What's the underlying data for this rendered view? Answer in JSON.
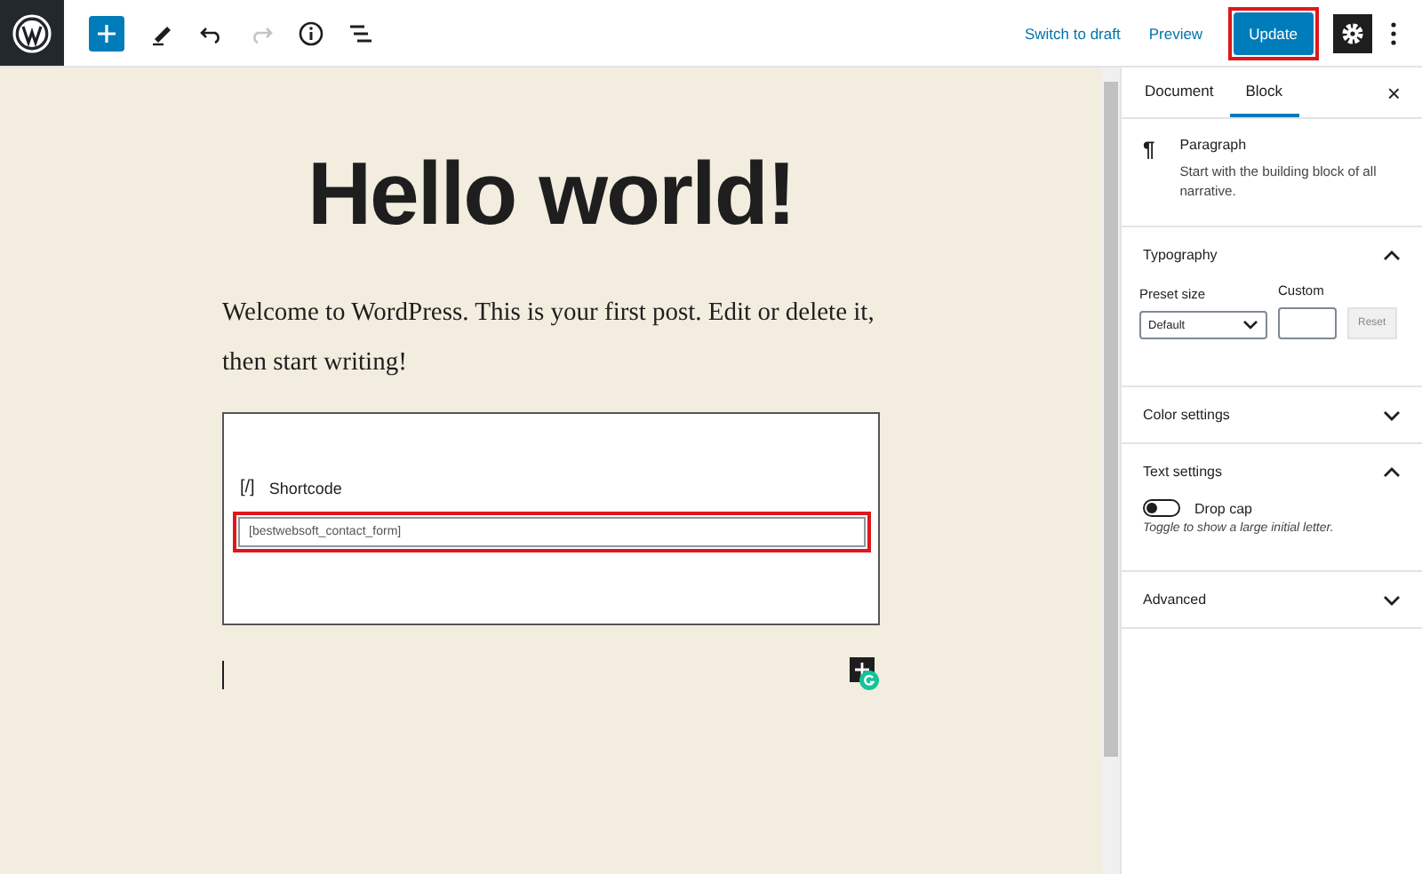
{
  "toolbar": {
    "actions": [
      {
        "label": "Switch to draft",
        "kind": "link"
      },
      {
        "label": "Preview",
        "kind": "link"
      },
      {
        "label": "Update",
        "kind": "primary",
        "highlighted": true
      }
    ],
    "settings_on": true
  },
  "post": {
    "title": "Hello world!",
    "paragraph": "Welcome to WordPress. This is your first post. Edit or delete it, then start writing!",
    "shortcode": {
      "label": "Shortcode",
      "icon": "[/]",
      "value": "[bestwebsoft_contact_form]",
      "highlighted": true
    }
  },
  "sidebar": {
    "tabs": [
      {
        "label": "Document",
        "selected": false
      },
      {
        "label": "Block",
        "selected": true
      }
    ],
    "close": "×",
    "block": {
      "icon": "¶",
      "name": "Paragraph",
      "description": "Start with the building block of all narrative."
    },
    "panels": [
      {
        "kind": "typography",
        "title": "Typography",
        "expanded": true,
        "preset_label": "Preset size",
        "preset_value": "Default",
        "custom_label": "Custom",
        "reset": "Reset"
      },
      {
        "kind": "plain",
        "title": "Color settings",
        "expanded": false
      },
      {
        "kind": "text",
        "title": "Text settings",
        "expanded": true,
        "toggle_label": "Drop cap",
        "on": false,
        "help": "Toggle to show a large initial letter."
      },
      {
        "kind": "plain",
        "title": "Advanced",
        "expanded": false
      }
    ]
  }
}
